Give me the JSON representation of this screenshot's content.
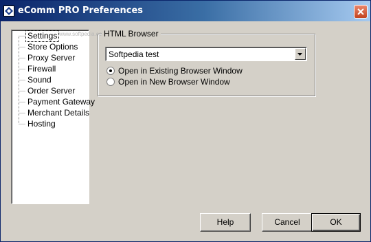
{
  "window": {
    "title": "eComm PRO Preferences",
    "title_bar_color": "#0a246a",
    "icon": "app-diamond-icon"
  },
  "watermark": "www.softpedia.com",
  "tree": {
    "items": [
      {
        "label": "Settings",
        "selected": true
      },
      {
        "label": "Store Options"
      },
      {
        "label": "Proxy Server"
      },
      {
        "label": "Firewall"
      },
      {
        "label": "Sound"
      },
      {
        "label": "Order Server"
      },
      {
        "label": "Payment Gateway"
      },
      {
        "label": "Merchant Details"
      },
      {
        "label": "Hosting"
      }
    ]
  },
  "html_browser": {
    "group_label": "HTML Browser",
    "browser_value": "Softpedia test",
    "options": [
      {
        "label": "Open in Existing Browser Window",
        "checked": true
      },
      {
        "label": "Open in New Browser Window",
        "checked": false
      }
    ]
  },
  "buttons": {
    "help": "Help",
    "cancel": "Cancel",
    "ok": "OK"
  }
}
